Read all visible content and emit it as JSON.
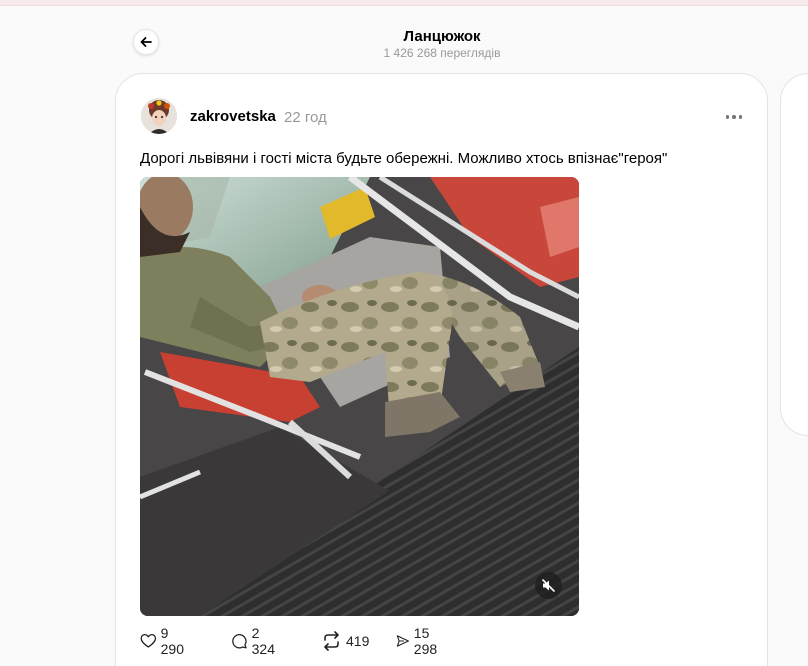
{
  "header": {
    "title": "Ланцюжок",
    "views": "1 426 268 переглядів"
  },
  "post": {
    "username": "zakrovetska",
    "time": "22 год",
    "text": "Дорогі львівяни і гості міста будьте обережні. Можливо хтось впізнає\"героя\"",
    "media": {
      "type": "video",
      "muted": true
    }
  },
  "actions": {
    "likes": "9 290",
    "comments": "2 324",
    "reposts": "419",
    "shares": "15 298"
  },
  "icons": {
    "back": "arrow-left-icon",
    "more": "more-horizontal-icon",
    "like": "heart-icon",
    "comment": "comment-icon",
    "repost": "repost-icon",
    "share": "share-icon",
    "mute": "speaker-muted-icon"
  },
  "colors": {
    "background": "#fafafa",
    "card": "#ffffff",
    "muted_text": "#999999",
    "seat_red": "#c9463a"
  }
}
